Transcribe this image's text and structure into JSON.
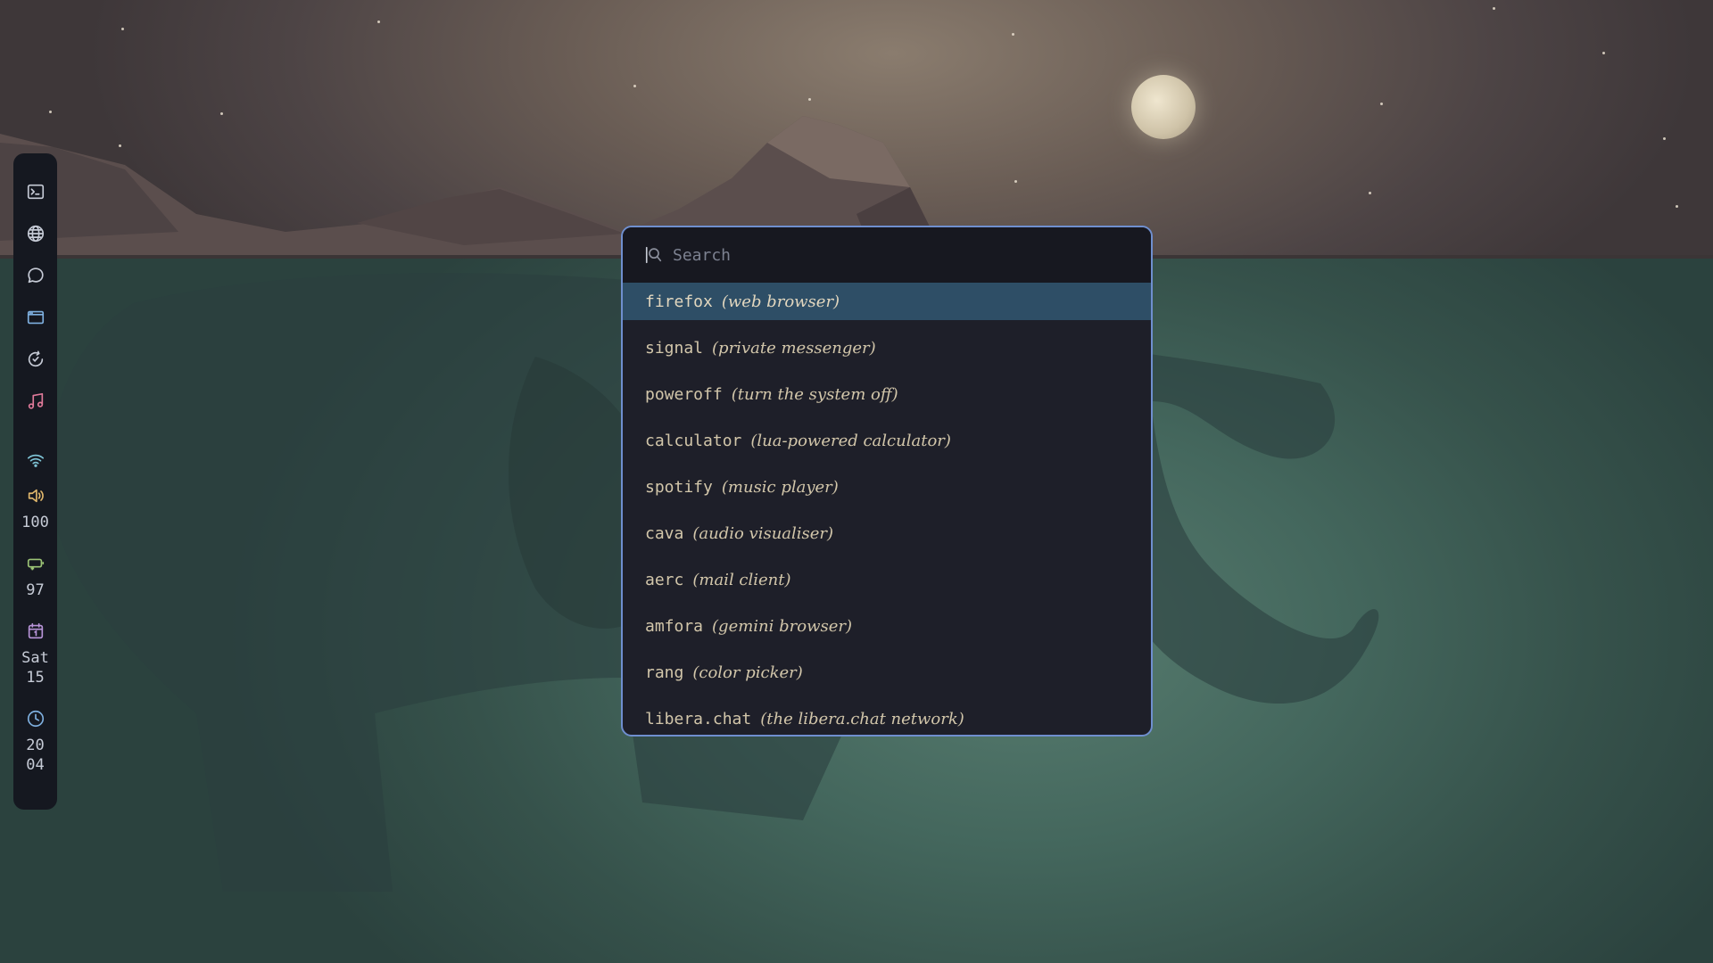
{
  "colors": {
    "bar_bg": "#151820",
    "launcher_bg": "#1e1f29",
    "launcher_border": "#6f8fcf",
    "selected_bg": "#2e4e66",
    "text": "#d2c6aa",
    "icon_default": "#c6cbd6",
    "icon_music": "#e07a9a",
    "icon_wifi": "#7fc4d6",
    "icon_volume": "#e2b86c",
    "icon_battery": "#9cc476",
    "icon_calendar": "#b894d8",
    "icon_clock": "#7fb0e0"
  },
  "bar": {
    "apps": [
      {
        "icon": "terminal-icon"
      },
      {
        "icon": "globe-icon"
      },
      {
        "icon": "chat-icon"
      },
      {
        "icon": "window-icon"
      },
      {
        "icon": "refresh-icon"
      },
      {
        "icon": "music-icon"
      }
    ],
    "status": {
      "wifi_icon": "wifi-icon",
      "volume_icon": "volume-icon",
      "volume": "100",
      "battery_icon": "battery-icon",
      "battery": "97",
      "calendar_icon": "calendar-icon",
      "day": "Sat",
      "date": "15",
      "clock_icon": "clock-icon",
      "hour": "20",
      "minute": "04"
    }
  },
  "launcher": {
    "search": {
      "placeholder": "Search",
      "value": ""
    },
    "results": [
      {
        "name": "firefox",
        "desc": "(web browser)",
        "selected": true
      },
      {
        "name": "signal",
        "desc": "(private messenger)"
      },
      {
        "name": "poweroff",
        "desc": "(turn the system off)"
      },
      {
        "name": "calculator",
        "desc": "(lua-powered calculator)"
      },
      {
        "name": "spotify",
        "desc": "(music player)"
      },
      {
        "name": "cava",
        "desc": "(audio visualiser)"
      },
      {
        "name": "aerc",
        "desc": "(mail client)"
      },
      {
        "name": "amfora",
        "desc": "(gemini browser)"
      },
      {
        "name": "rang",
        "desc": "(color picker)"
      },
      {
        "name": "libera.chat",
        "desc": "(the libera.chat network)"
      }
    ]
  }
}
